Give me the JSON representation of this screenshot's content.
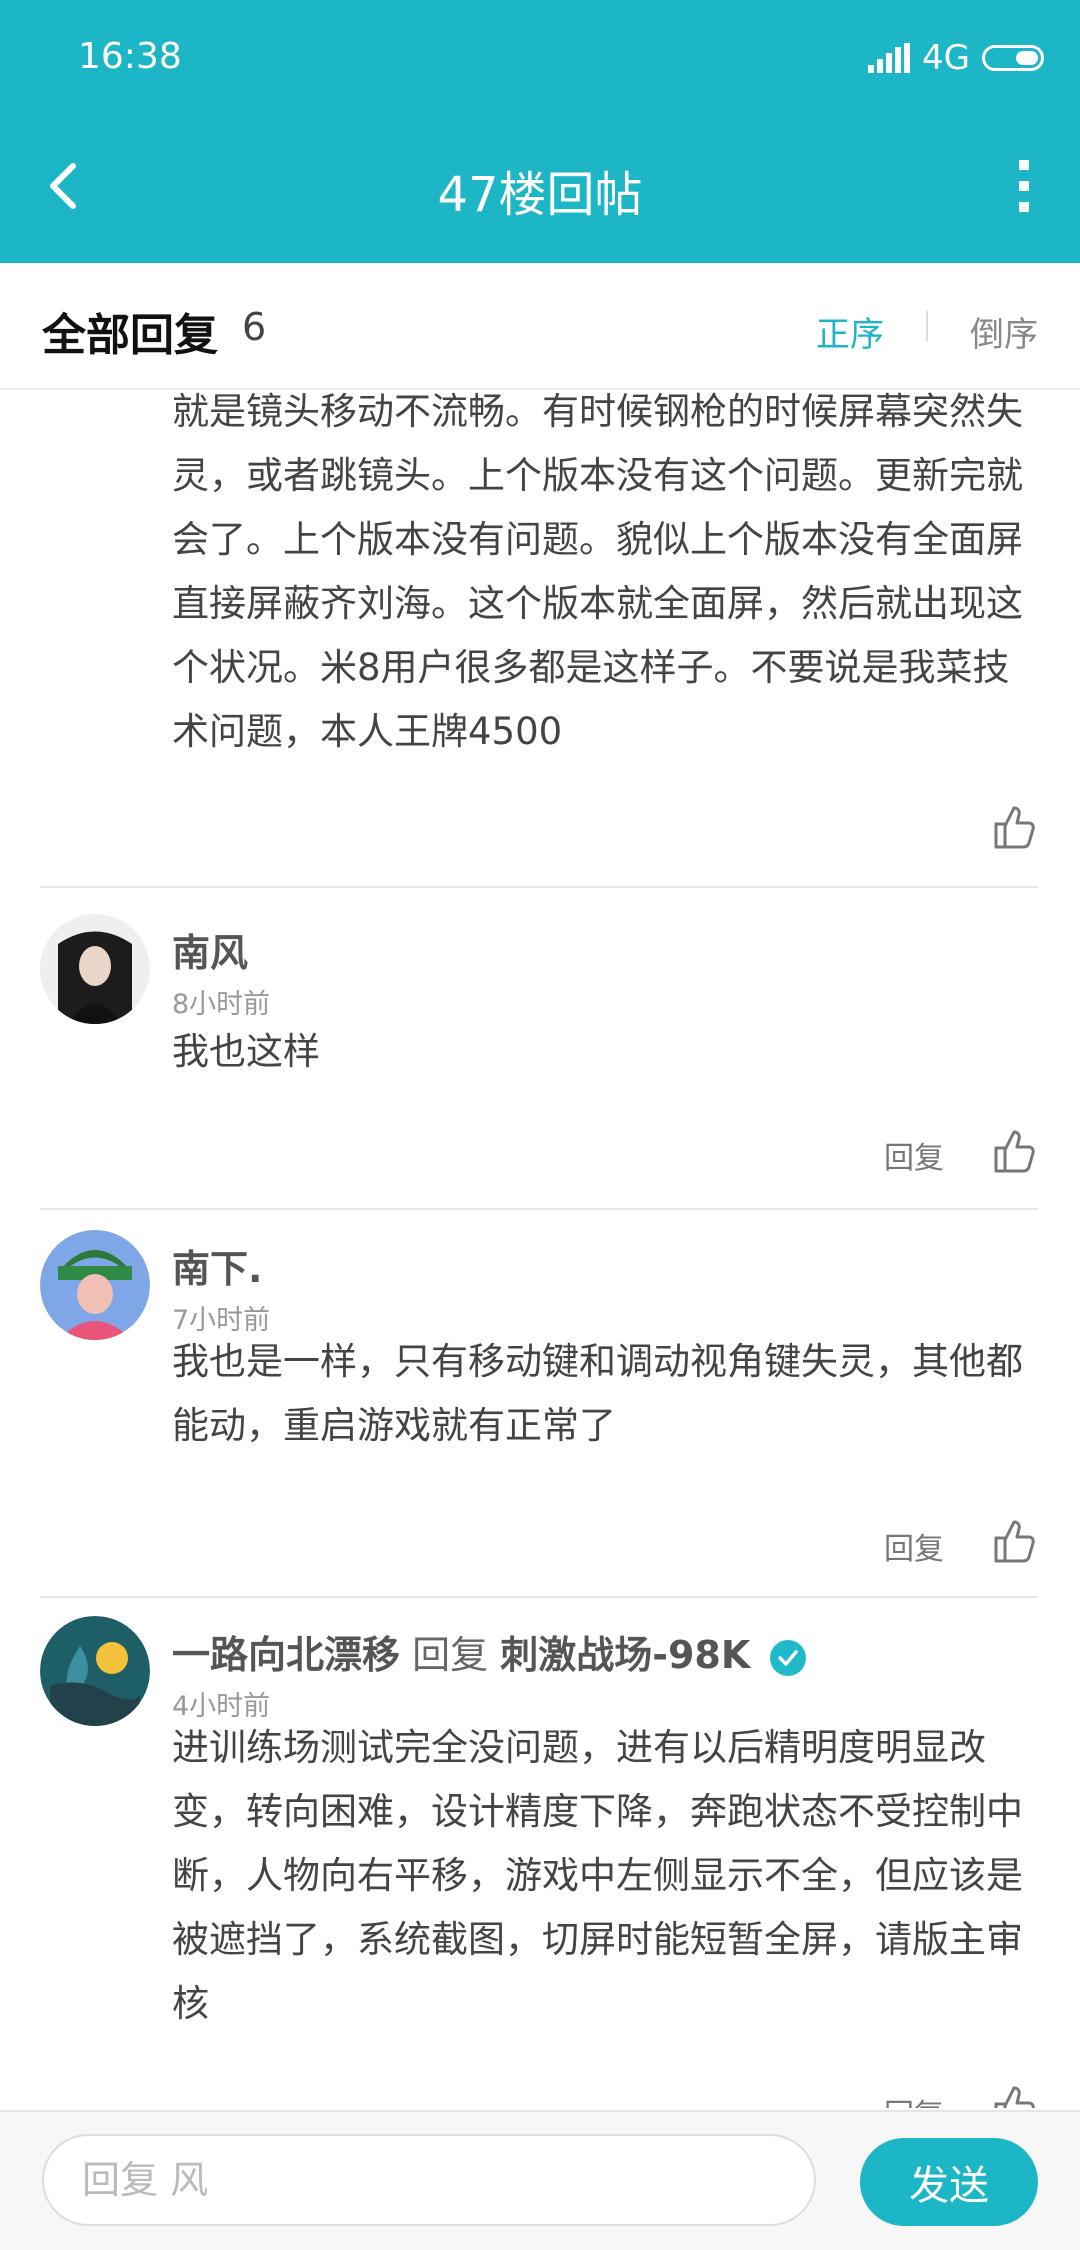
{
  "status_bar": {
    "time": "16:38",
    "network": "4G"
  },
  "header": {
    "title": "47楼回帖",
    "back_icon": "chevron-left-icon",
    "more_icon": "more-vertical-icon"
  },
  "sort_bar": {
    "title": "全部回复",
    "count": "6",
    "asc_label": "正序",
    "desc_label": "倒序"
  },
  "posts": [
    {
      "body": "就是镜头移动不流畅。有时候钢枪的时候屏幕突然失灵，或者跳镜头。上个版本没有这个问题。更新完就会了。上个版本没有问题。貌似上个版本没有全面屏直接屏蔽齐刘海。这个版本就全面屏，然后就出现这个状况。米8用户很多都是这样子。不要说是我菜技术问题，本人王牌4500"
    },
    {
      "name": "南风",
      "time": "8小时前",
      "body": "我也这样",
      "reply_label": "回复"
    },
    {
      "name": "南下.",
      "time": "7小时前",
      "body": "我也是一样，只有移动键和调动视角键失灵，其他都能动，重启游戏就有正常了",
      "reply_label": "回复"
    },
    {
      "name": "一路向北漂移",
      "reply_word": "回复",
      "reply_to": "刺激战场-98K",
      "time": "4小时前",
      "body": "进训练场测试完全没问题，进有以后精明度明显改变，转向困难，设计精度下降，奔跑状态不受控制中断，人物向右平移，游戏中左侧显示不全，但应该是被遮挡了，系统截图，切屏时能短暂全屏，请版主审核",
      "reply_label": "回复"
    }
  ],
  "bottom_bar": {
    "input_placeholder": "回复 风",
    "send_label": "发送"
  },
  "colors": {
    "accent": "#1cb6c6"
  }
}
